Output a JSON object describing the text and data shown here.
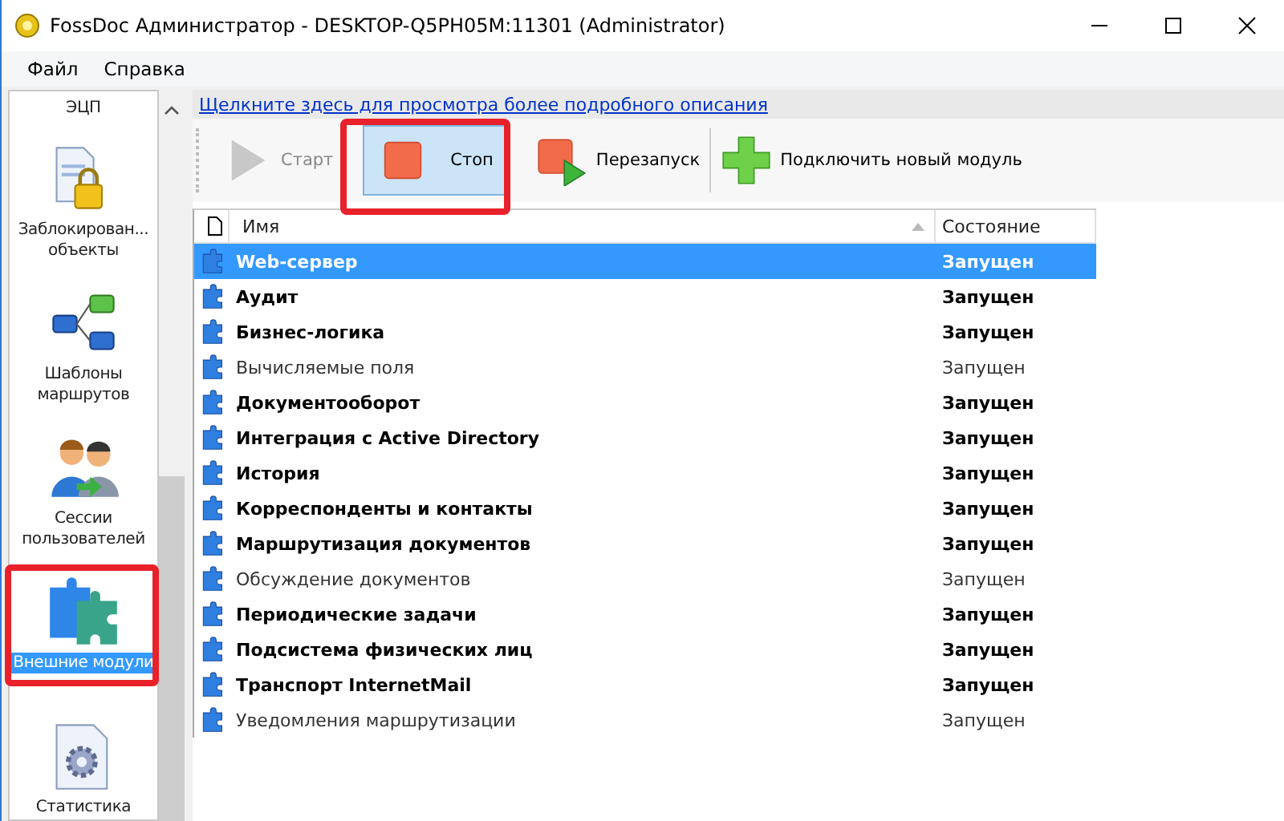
{
  "window": {
    "title": "FossDoc Администратор - DESKTOP-Q5PH05M:11301 (Administrator)"
  },
  "menu": [
    "Файл",
    "Справка"
  ],
  "sidebar": {
    "items": [
      {
        "label": "ЭЦП",
        "kind": "text",
        "selected": false
      },
      {
        "label": "Заблокирован...\nобъекты",
        "kind": "lock",
        "selected": false
      },
      {
        "label": "Шаблоны\nмаршрутов",
        "kind": "routes",
        "selected": false
      },
      {
        "label": "Сессии\nпользователей",
        "kind": "users",
        "selected": false
      },
      {
        "label": "Внешние модули",
        "kind": "puzzle",
        "selected": true
      },
      {
        "label": "Статистика",
        "kind": "stats",
        "selected": false
      }
    ]
  },
  "info_link": "Щелкните здесь для просмотра более подробного описания",
  "toolbar": [
    {
      "label": "Старт",
      "kind": "start",
      "disabled": true,
      "pressed": false
    },
    {
      "label": "Стоп",
      "kind": "stop",
      "disabled": false,
      "pressed": true
    },
    {
      "label": "Перезапуск",
      "kind": "restart",
      "disabled": false,
      "pressed": false
    },
    {
      "label": "Подключить новый модуль",
      "kind": "add",
      "disabled": false,
      "pressed": false
    }
  ],
  "table": {
    "columns": [
      "Имя",
      "Состояние"
    ],
    "rows": [
      {
        "name": "Web-сервер",
        "state": "Запущен",
        "bold": true,
        "selected": true
      },
      {
        "name": "Аудит",
        "state": "Запущен",
        "bold": true,
        "selected": false
      },
      {
        "name": "Бизнес-логика",
        "state": "Запущен",
        "bold": true,
        "selected": false
      },
      {
        "name": "Вычисляемые поля",
        "state": "Запущен",
        "bold": false,
        "selected": false
      },
      {
        "name": "Документооборот",
        "state": "Запущен",
        "bold": true,
        "selected": false
      },
      {
        "name": "Интеграция с Active Directory",
        "state": "Запущен",
        "bold": true,
        "selected": false
      },
      {
        "name": "История",
        "state": "Запущен",
        "bold": true,
        "selected": false
      },
      {
        "name": "Корреспонденты и контакты",
        "state": "Запущен",
        "bold": true,
        "selected": false
      },
      {
        "name": "Маршрутизация документов",
        "state": "Запущен",
        "bold": true,
        "selected": false
      },
      {
        "name": "Обсуждение документов",
        "state": "Запущен",
        "bold": false,
        "selected": false
      },
      {
        "name": "Периодические задачи",
        "state": "Запущен",
        "bold": true,
        "selected": false
      },
      {
        "name": "Подсистема физических лиц",
        "state": "Запущен",
        "bold": true,
        "selected": false
      },
      {
        "name": "Транспорт InternetMail",
        "state": "Запущен",
        "bold": true,
        "selected": false
      },
      {
        "name": "Уведомления маршрутизации",
        "state": "Запущен",
        "bold": false,
        "selected": false
      }
    ]
  }
}
